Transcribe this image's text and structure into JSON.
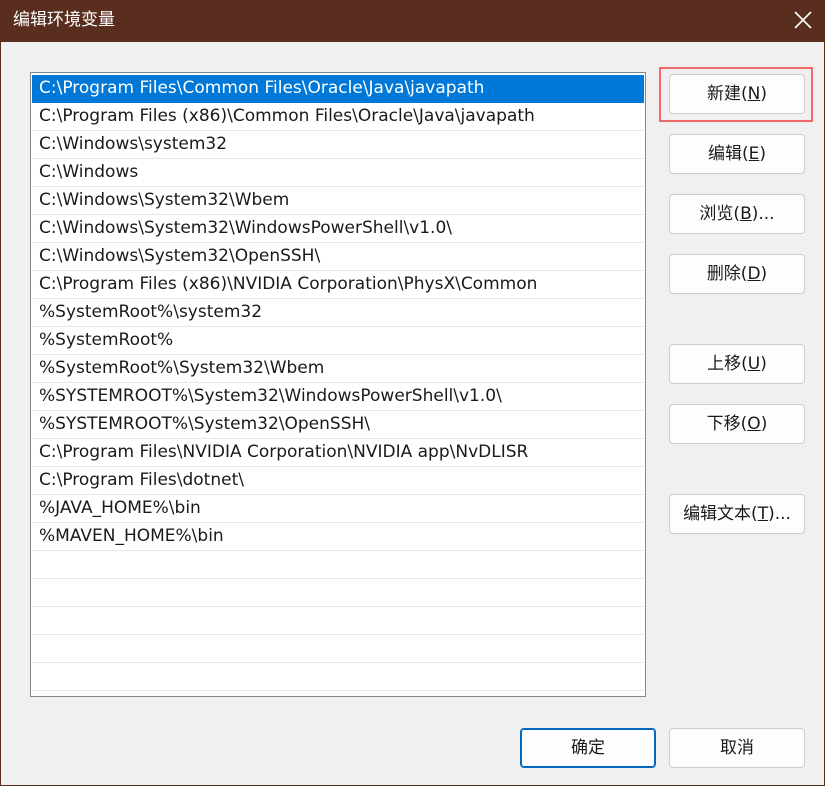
{
  "window": {
    "title": "编辑环境变量",
    "titlebar_color": "#5a2e1f",
    "selection_color": "#0078d7",
    "highlight_color": "#f06a6a"
  },
  "list": {
    "items": [
      "C:\\Program Files\\Common Files\\Oracle\\Java\\javapath",
      "C:\\Program Files (x86)\\Common Files\\Oracle\\Java\\javapath",
      "C:\\Windows\\system32",
      "C:\\Windows",
      "C:\\Windows\\System32\\Wbem",
      "C:\\Windows\\System32\\WindowsPowerShell\\v1.0\\",
      "C:\\Windows\\System32\\OpenSSH\\",
      "C:\\Program Files (x86)\\NVIDIA Corporation\\PhysX\\Common",
      "%SystemRoot%\\system32",
      "%SystemRoot%",
      "%SystemRoot%\\System32\\Wbem",
      "%SYSTEMROOT%\\System32\\WindowsPowerShell\\v1.0\\",
      "%SYSTEMROOT%\\System32\\OpenSSH\\",
      "C:\\Program Files\\NVIDIA Corporation\\NVIDIA app\\NvDLISR",
      "C:\\Program Files\\dotnet\\",
      "%JAVA_HOME%\\bin",
      "%MAVEN_HOME%\\bin"
    ],
    "selected_index": 0
  },
  "buttons": {
    "new": {
      "label": "新建(",
      "hotkey": "N",
      "suffix": ")"
    },
    "edit": {
      "label": "编辑(",
      "hotkey": "E",
      "suffix": ")"
    },
    "browse": {
      "label": "浏览(",
      "hotkey": "B",
      "suffix": ")..."
    },
    "delete": {
      "label": "删除(",
      "hotkey": "D",
      "suffix": ")"
    },
    "move_up": {
      "label": "上移(",
      "hotkey": "U",
      "suffix": ")"
    },
    "move_down": {
      "label": "下移(",
      "hotkey": "O",
      "suffix": ")"
    },
    "edit_text": {
      "label": "编辑文本(",
      "hotkey": "T",
      "suffix": ")..."
    },
    "ok": {
      "label": "确定"
    },
    "cancel": {
      "label": "取消"
    }
  },
  "icons": {
    "close": "close-icon"
  }
}
